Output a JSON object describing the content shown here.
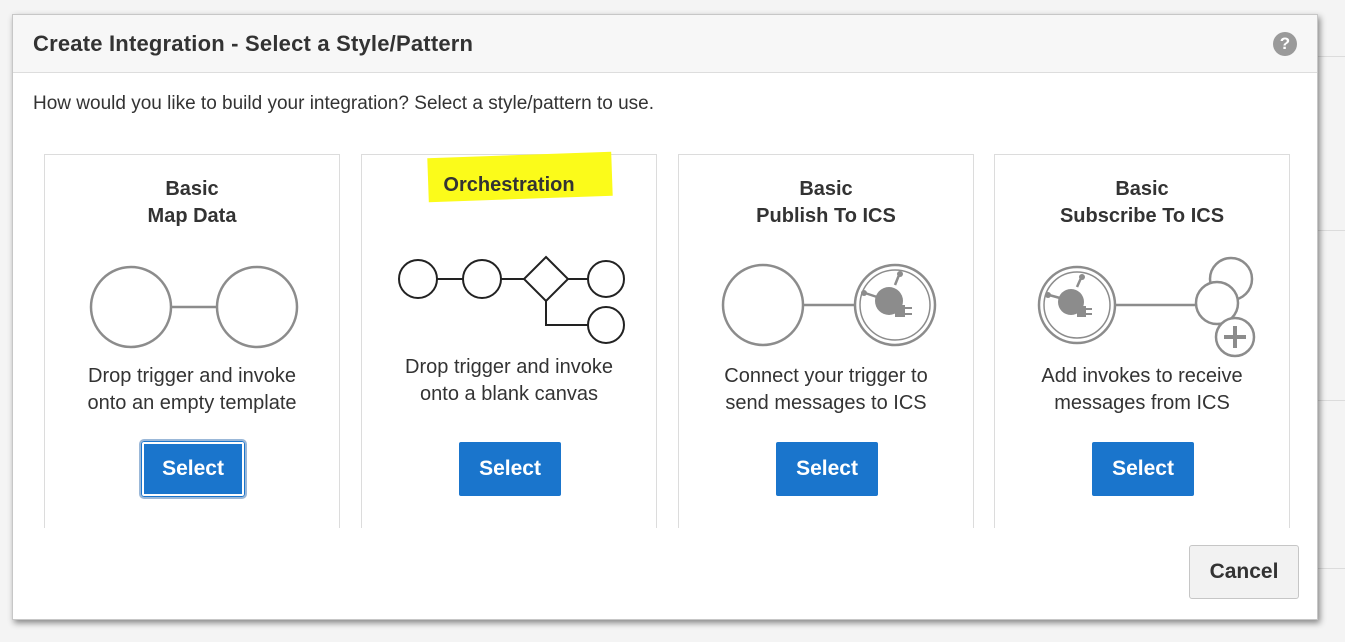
{
  "dialog": {
    "title": "Create Integration - Select a Style/Pattern",
    "help_glyph": "?",
    "intro": "How would you like to build your integration? Select a style/pattern to use."
  },
  "cards": [
    {
      "title_line1": "Basic",
      "title_line2": "Map Data",
      "desc_line1": "Drop trigger and invoke",
      "desc_line2": "onto an empty template",
      "button": "Select",
      "icon": "two-nodes-diagram-icon"
    },
    {
      "title_line1": "Orchestration",
      "desc_line1": "Drop trigger and invoke",
      "desc_line2": "onto a blank canvas",
      "button": "Select",
      "highlight_color": "#fbfb1a",
      "icon": "orchestration-flow-diagram-icon"
    },
    {
      "title_line1": "Basic",
      "title_line2": "Publish To ICS",
      "desc_line1": "Connect your trigger to",
      "desc_line2": "send messages to ICS",
      "button": "Select",
      "icon": "publish-diagram-icon"
    },
    {
      "title_line1": "Basic",
      "title_line2": "Subscribe To ICS",
      "desc_line1": "Add invokes to receive",
      "desc_line2": "messages from ICS",
      "button": "Select",
      "icon": "subscribe-diagram-icon"
    }
  ],
  "footer": {
    "cancel": "Cancel"
  },
  "colors": {
    "primary_button": "#1a75cc",
    "highlight": "#fbfb1a",
    "diagram_stroke": "#8c8c8c"
  }
}
